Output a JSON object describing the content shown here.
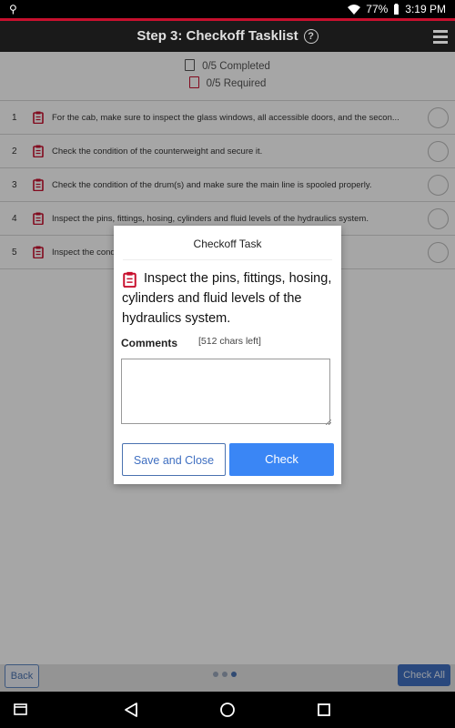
{
  "status_bar": {
    "usb_icon": "usb-icon",
    "battery": "77%",
    "time": "3:19 PM"
  },
  "header": {
    "title": "Step 3: Checkoff Tasklist",
    "help_icon_label": "?"
  },
  "summary": {
    "completed": "0/5 Completed",
    "required": "0/5 Required"
  },
  "tasks": [
    {
      "num": "1",
      "text": "For the cab, make sure to inspect the glass windows, all accessible doors, and the secon..."
    },
    {
      "num": "2",
      "text": "Check the condition of the counterweight and secure it."
    },
    {
      "num": "3",
      "text": "Check the condition of the drum(s) and make sure the main line is spooled properly."
    },
    {
      "num": "4",
      "text": "Inspect the pins, fittings, hosing, cylinders and fluid levels of the hydraulics system."
    },
    {
      "num": "5",
      "text": "Inspect the condition of the pump(s) and make sure there are no leaks."
    }
  ],
  "dialog": {
    "title": "Checkoff Task",
    "task_text": "Inspect the pins, fittings, hosing, cylinders and fluid levels of the hydraulics system.",
    "comments_label": "Comments",
    "chars_left": "[512 chars left]",
    "comment_value": "",
    "save_label": "Save and Close",
    "check_label": "Check"
  },
  "footer": {
    "back_label": "Back",
    "check_all_label": "Check All",
    "page_count": 3,
    "active_page": 3
  },
  "colors": {
    "accent_red": "#c8102e",
    "primary_blue": "#3a86f5",
    "dark_header": "#1a1a1a"
  }
}
